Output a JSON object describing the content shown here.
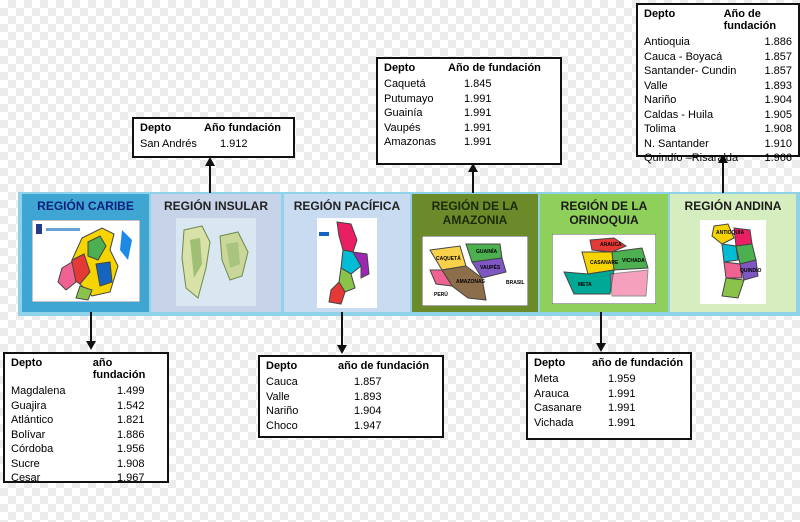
{
  "panels": [
    {
      "title": "REGIÓN CARIBE",
      "bg": "#3fa6d4",
      "color": "#0b1f7a"
    },
    {
      "title": "REGIÓN INSULAR",
      "bg": "#c7d3e8",
      "color": "#222222"
    },
    {
      "title": "REGIÓN PACÍFICA",
      "bg": "#c9dbf0",
      "color": "#222222"
    },
    {
      "title": "REGIÓN DE LA\nAMAZONIA",
      "bg": "#6b8a2a",
      "color": "#1a2a0a"
    },
    {
      "title": "REGIÓN DE LA\nORINOQUIA",
      "bg": "#8fd05a",
      "color": "#1a1a1a"
    },
    {
      "title": "REGIÓN ANDINA",
      "bg": "#d6edc0",
      "color": "#1a1a1a"
    }
  ],
  "tables": {
    "caribe": {
      "head1": "Depto",
      "head2": "año fundación",
      "rows": [
        {
          "d": "Magdalena",
          "y": "1.499"
        },
        {
          "d": "Guajira",
          "y": "1.542"
        },
        {
          "d": "Atlántico",
          "y": "1.821"
        },
        {
          "d": "Bolívar",
          "y": "1.886"
        },
        {
          "d": "Córdoba",
          "y": "1.956"
        },
        {
          "d": "Sucre",
          "y": "1.908"
        },
        {
          "d": "Cesar",
          "y": "1.967"
        }
      ]
    },
    "insular": {
      "head1": "Depto",
      "head2": "Año fundación",
      "rows": [
        {
          "d": "San Andrés",
          "y": "1.912"
        }
      ]
    },
    "pacifica": {
      "head1": "Depto",
      "head2": "año de fundación",
      "rows": [
        {
          "d": "Cauca",
          "y": "1.857"
        },
        {
          "d": "Valle",
          "y": "1.893"
        },
        {
          "d": "Nariño",
          "y": "1.904"
        },
        {
          "d": "Choco",
          "y": "1.947"
        }
      ]
    },
    "amazonia": {
      "head1": "Depto",
      "head2": "Año de fundación",
      "rows": [
        {
          "d": "Caquetá",
          "y": "1.845"
        },
        {
          "d": "Putumayo",
          "y": "1.991"
        },
        {
          "d": "Guainía",
          "y": "1.991"
        },
        {
          "d": "Vaupés",
          "y": "1.991"
        },
        {
          "d": "Amazonas",
          "y": "1.991"
        }
      ]
    },
    "orinoquia": {
      "head1": "Depto",
      "head2": "año de fundación",
      "rows": [
        {
          "d": "Meta",
          "y": "1.959"
        },
        {
          "d": "Arauca",
          "y": "1.991"
        },
        {
          "d": "Casanare",
          "y": "1.991"
        },
        {
          "d": "Vichada",
          "y": "1.991"
        }
      ]
    },
    "andina": {
      "head1": "Depto",
      "head2": "Año de fundación",
      "rows": [
        {
          "d": "Antioquia",
          "y": "1.886"
        },
        {
          "d": "Cauca - Boyacá",
          "y": "1.857"
        },
        {
          "d": "Santander- Cundin",
          "y": "1.857"
        },
        {
          "d": "Valle",
          "y": "1.893"
        },
        {
          "d": "Nariño",
          "y": "1.904"
        },
        {
          "d": "Caldas  - Huila",
          "y": "1.905"
        },
        {
          "d": "Tolima",
          "y": "1.908"
        },
        {
          "d": "N. Santander",
          "y": "1.910"
        },
        {
          "d": "Quindío –Risaralda",
          "y": "1.966"
        }
      ]
    }
  },
  "map_labels": {
    "amazonia": [
      "CAQUETÁ",
      "GUAINÍA",
      "VAUPÉS",
      "AMAZONAS",
      "PERÚ",
      "BRASIL"
    ],
    "orinoquia": [
      "ARAUCA",
      "CASANARE",
      "VICHADA",
      "META"
    ],
    "andina": [
      "ANTIOQUIA",
      "QUINDÍO"
    ]
  }
}
